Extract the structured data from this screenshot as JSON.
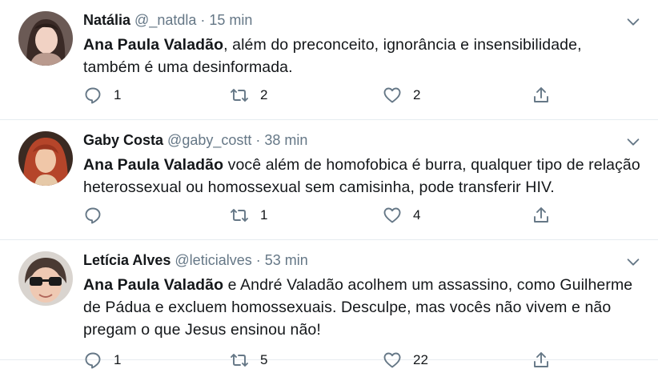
{
  "colors": {
    "icon": "#657786",
    "divider": "#e6ecf0",
    "text": "#14171a"
  },
  "tweets": [
    {
      "name": "Natália",
      "handle": "@_natdla",
      "separator": "·",
      "time": "15 min",
      "mention": "Ana Paula Valadão",
      "text": ", além do preconceito, ignorância e insensibilidade, também é uma desinformada.",
      "replies": "1",
      "retweets": "2",
      "likes": "2",
      "avatar": "avatar-woman-dark-hair"
    },
    {
      "name": "Gaby Costa",
      "handle": "@gaby_costt",
      "separator": "·",
      "time": "38 min",
      "mention": "Ana Paula Valadão",
      "text": " você além de homofobica é burra, qualquer tipo de relação heterossexual ou homossexual sem camisinha, pode transferir HIV.",
      "replies": "",
      "retweets": "1",
      "likes": "4",
      "avatar": "avatar-woman-red-hair"
    },
    {
      "name": "Letícia Alves",
      "handle": "@leticialves",
      "separator": "·",
      "time": "53 min",
      "mention": "Ana Paula Valadão",
      "text": " e André Valadão acolhem um assassino, como Guilherme de Pádua e excluem homossexuais. Desculpe, mas vocês não vivem e não pregam o que Jesus ensinou não!",
      "replies": "1",
      "retweets": "5",
      "likes": "22",
      "avatar": "avatar-woman-glasses"
    }
  ]
}
